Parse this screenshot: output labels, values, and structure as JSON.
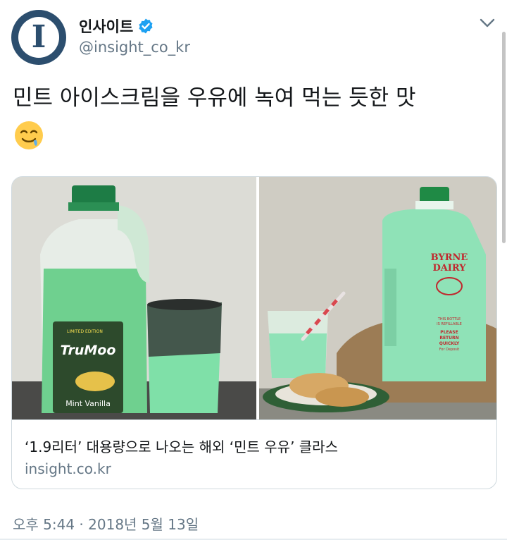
{
  "account": {
    "display_name": "인사이트",
    "handle": "@insight_co_kr",
    "avatar_letter": "I",
    "avatar_color": "#2c4e6e",
    "verified_color": "#1da1f2"
  },
  "tweet": {
    "text": "민트 아이스크림을 우유에 녹여 먹는 듯한 맛",
    "emoji": "drooling-face-emoji"
  },
  "card": {
    "title": "‘1.9리터’ 대용량으로 나오는 해외 ‘민트 우유’ 클라스",
    "domain": "insight.co.kr",
    "left_image": {
      "label_brand": "TruMoo",
      "label_flavor": "Mint Vanilla",
      "label_badge": "LIMITED EDITION"
    },
    "right_image": {
      "label_brand_line1": "BYRNE",
      "label_brand_line2": "DAIRY",
      "label_small1": "THIS BOTTLE",
      "label_small2": "IS REFILLABLE",
      "label_please1": "PLEASE",
      "label_please2": "RETURN",
      "label_please3": "QUICKLY",
      "label_small3": "For Deposit"
    }
  },
  "timestamp": "오후 5:44 · 2018년 5월 13일",
  "colors": {
    "mint": "#7fd9a6",
    "text_secondary": "#657786"
  }
}
